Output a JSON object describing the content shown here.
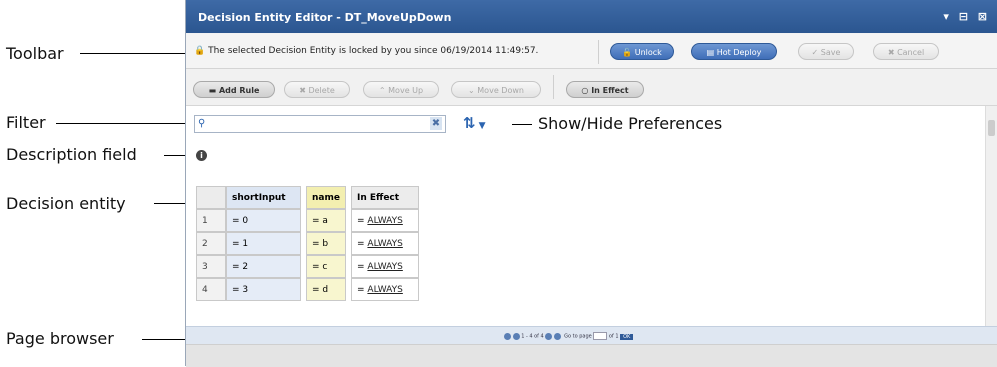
{
  "callouts": {
    "toolbar": "Toolbar",
    "filter": "Filter",
    "description_field": "Description field",
    "decision_entity": "Decision entity",
    "page_browser": "Page browser",
    "show_hide_preferences": "Show/Hide Preferences"
  },
  "window": {
    "title": "Decision Entity Editor - DT_MoveUpDown",
    "controls": "▾ ⊟ ⊠"
  },
  "toolbar": {
    "lock_message": "The selected Decision Entity is locked by you since 06/19/2014 11:49:57.",
    "unlock_label": "Unlock",
    "hot_deploy_label": "Hot Deploy",
    "save_label": "Save",
    "cancel_label": "Cancel"
  },
  "rule_toolbar": {
    "add_rule_label": "Add Rule",
    "delete_label": "Delete",
    "move_up_label": "Move Up",
    "move_down_label": "Move Down",
    "in_effect_label": "In Effect"
  },
  "table": {
    "columns": [
      "shortInput",
      "name",
      "In Effect"
    ],
    "rows": [
      {
        "num": "1",
        "shortInput": "= 0",
        "name": "= a",
        "op": "=",
        "in_effect": "ALWAYS"
      },
      {
        "num": "2",
        "shortInput": "= 1",
        "name": "= b",
        "op": "=",
        "in_effect": "ALWAYS"
      },
      {
        "num": "3",
        "shortInput": "= 2",
        "name": "= c",
        "op": "=",
        "in_effect": "ALWAYS"
      },
      {
        "num": "4",
        "shortInput": "= 3",
        "name": "= d",
        "op": "=",
        "in_effect": "ALWAYS"
      }
    ]
  },
  "page_browser": {
    "range": "1 - 4 of 4",
    "goto_label": "Go to page",
    "of_label": "of 1",
    "go_label": "OK"
  },
  "colors": {
    "title_bar": "#2f5a98",
    "blue_button": "#4f7ec4",
    "highlight_column": "#f3efb0",
    "selected_column": "#dde6f3"
  }
}
